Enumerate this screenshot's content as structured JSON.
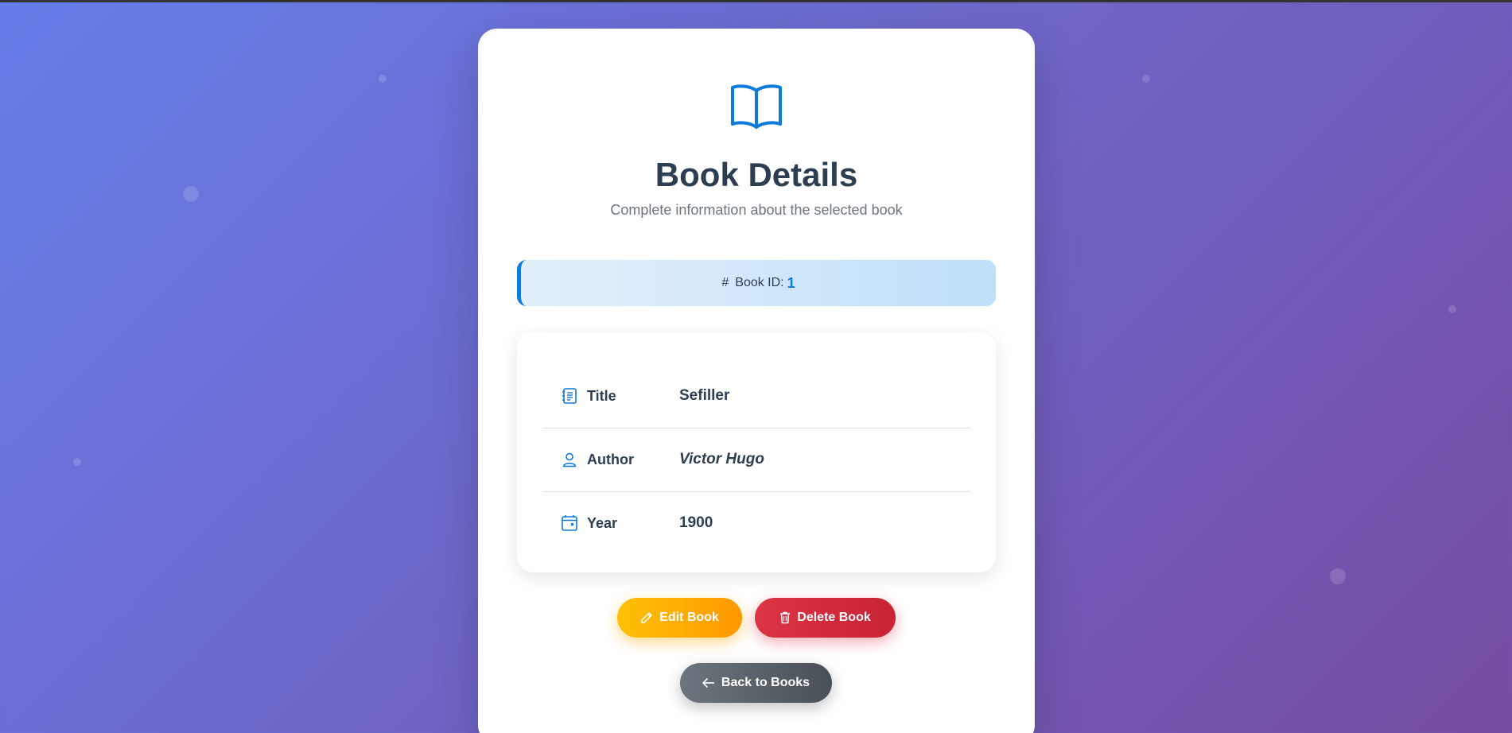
{
  "header": {
    "icon": "open-book-icon",
    "title": "Book Details",
    "subtitle": "Complete information about the selected book"
  },
  "id_banner": {
    "icon": "hash-icon",
    "hash_symbol": "#",
    "label": "Book ID:",
    "value": "1"
  },
  "details": {
    "rows": [
      {
        "icon": "journal-text-icon",
        "label": "Title",
        "value": "Sefiller"
      },
      {
        "icon": "person-icon",
        "label": "Author",
        "value": "Victor Hugo"
      },
      {
        "icon": "calendar-icon",
        "label": "Year",
        "value": "1900"
      }
    ]
  },
  "actions": {
    "edit_label": "Edit Book",
    "delete_label": "Delete Book",
    "back_label": "Back to Books"
  },
  "colors": {
    "accent": "#0d7bdc",
    "edit": "#ffc107",
    "delete": "#dc3545",
    "back": "#6c757d",
    "heading": "#2c3e50"
  }
}
